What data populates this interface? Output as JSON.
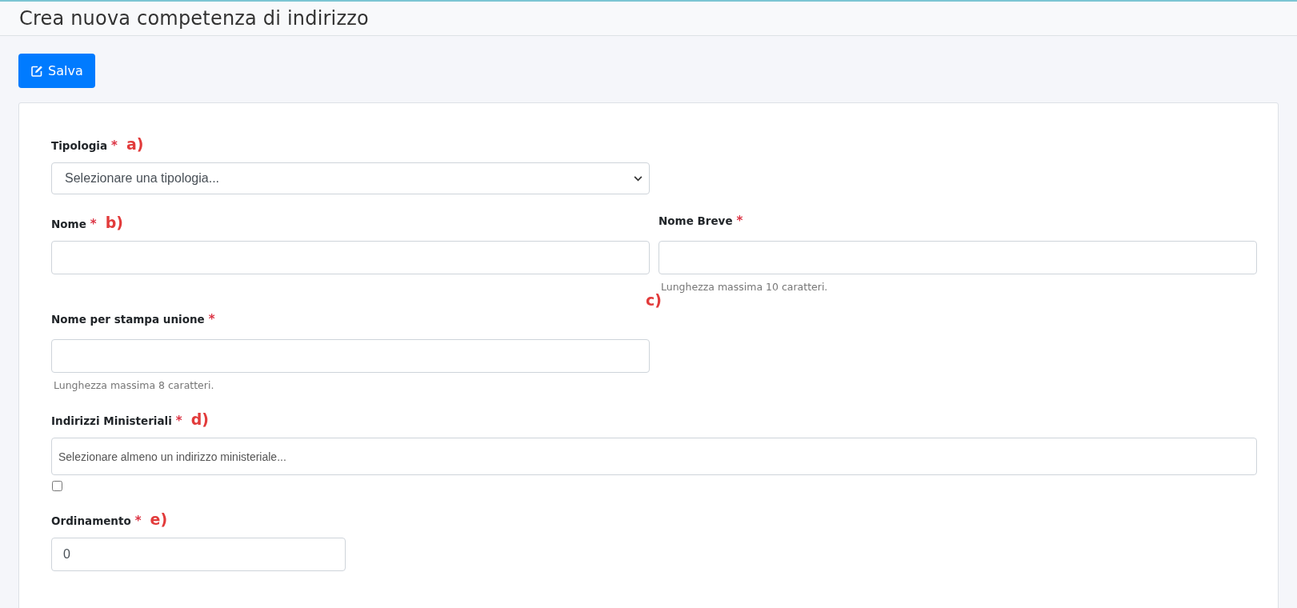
{
  "page_title": "Crea nuova competenza di indirizzo",
  "save_button": {
    "label": "Salva"
  },
  "rows": [
    [
      {
        "kind": "select",
        "label": "Tipologia",
        "required_mark": "*",
        "annotation": "a)",
        "placeholder": "Selezionare una tipologia..."
      }
    ],
    [
      {
        "kind": "text",
        "label": "Nome",
        "required_mark": "*",
        "annotation": "b)"
      },
      {
        "kind": "text",
        "label": "Nome Breve",
        "required_mark": "*",
        "help": "Lunghezza massima 10 caratteri."
      }
    ],
    [
      {
        "kind": "text",
        "label": "Nome per stampa unione",
        "required_mark": "*",
        "side_annotation": "c)",
        "help": "Lunghezza massima 8 caratteri."
      }
    ],
    [
      {
        "kind": "multiselect",
        "label": "Indirizzi Ministeriali",
        "required_mark": "*",
        "annotation": "d)",
        "placeholder": "Selezionare almeno un indirizzo ministeriale...",
        "checkbox": {
          "checked": false
        }
      }
    ],
    [
      {
        "kind": "number",
        "label": "Ordinamento",
        "required_mark": "*",
        "annotation": "e)",
        "value": "0"
      }
    ]
  ]
}
